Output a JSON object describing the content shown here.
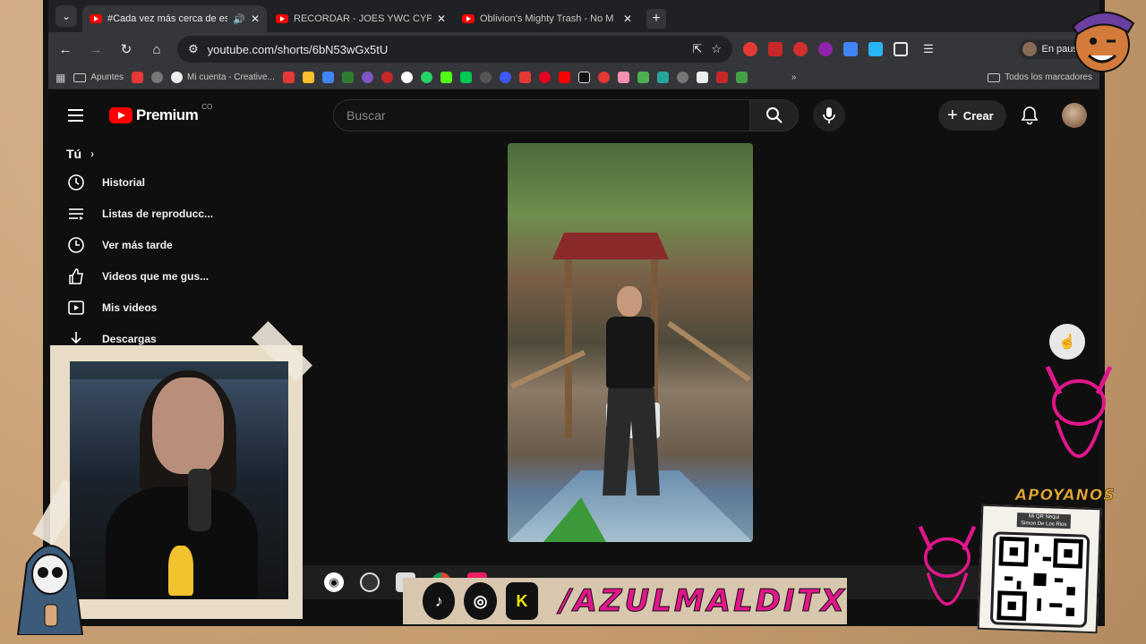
{
  "browser": {
    "tabs": [
      {
        "title": "#Cada vez más cerca de est",
        "active": true
      },
      {
        "title": "RECORDAR - JOES YWC CYPHE",
        "active": false
      },
      {
        "title": "Oblivion's Mighty Trash - No M",
        "active": false
      }
    ],
    "url": "youtube.com/shorts/6bN53wGx5tU",
    "profile_status": "En pausa",
    "bookmarks": [
      "Apuntes",
      "Mi cuenta - Creative..."
    ],
    "all_bookmarks": "Todos los marcadores"
  },
  "youtube": {
    "logo_text": "Premium",
    "logo_suffix": "CO",
    "search_placeholder": "Buscar",
    "create_label": "Crear",
    "sidebar": {
      "section": "Tú",
      "items": [
        {
          "label": "Historial",
          "icon": "history-icon"
        },
        {
          "label": "Listas de reproducc...",
          "icon": "playlist-icon"
        },
        {
          "label": "Ver más tarde",
          "icon": "clock-icon"
        },
        {
          "label": "Videos que me gus...",
          "icon": "thumbs-up-icon"
        },
        {
          "label": "Mis videos",
          "icon": "my-videos-icon"
        },
        {
          "label": "Descargas",
          "icon": "download-icon"
        }
      ]
    }
  },
  "overlay": {
    "handle": "/AZULMALDITX",
    "support_text": "APOYANOS",
    "qr_label_line1": "Mi QR Nequi",
    "qr_label_line2": "Simon De Los Rios"
  },
  "colors": {
    "accent": "#ff0000",
    "brand_pink": "#e0178a",
    "background": "#0f0f0f"
  }
}
